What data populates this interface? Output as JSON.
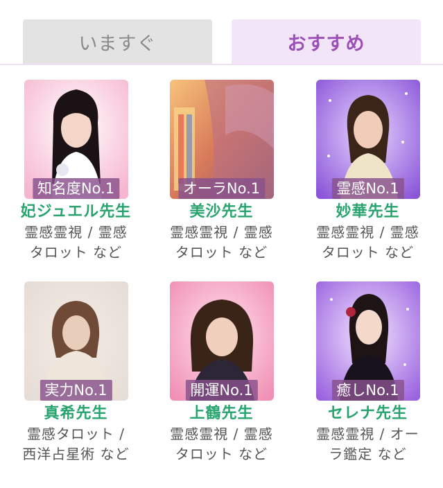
{
  "tabs": {
    "now_label": "いますぐ",
    "recommend_label": "おすすめ"
  },
  "fortune_tellers": [
    {
      "rank": "知名度No.1",
      "name": "妃ジュエル先生",
      "genre_line1": "霊感霊視 / 霊感",
      "genre_line2": "タロット など"
    },
    {
      "rank": "オーラNo.1",
      "name": "美沙先生",
      "genre_line1": "霊感霊視 / 霊感",
      "genre_line2": "タロット など"
    },
    {
      "rank": "霊感No.1",
      "name": "妙華先生",
      "genre_line1": "霊感霊視 / 霊感",
      "genre_line2": "タロット など"
    },
    {
      "rank": "実力No.1",
      "name": "真希先生",
      "genre_line1": "霊感タロット /",
      "genre_line2": "西洋占星術 など"
    },
    {
      "rank": "開運No.1",
      "name": "上鶴先生",
      "genre_line1": "霊感霊視 / 霊感",
      "genre_line2": "タロット など"
    },
    {
      "rank": "癒しNo.1",
      "name": "セレナ先生",
      "genre_line1": "霊感霊視 / オー",
      "genre_line2": "ラ鑑定 など"
    }
  ],
  "colors": {
    "accent_purple": "#9b4fb7",
    "name_green": "#27a46d",
    "tab_inactive": "#e3e3e3",
    "tab_active": "#f1e5f7"
  }
}
